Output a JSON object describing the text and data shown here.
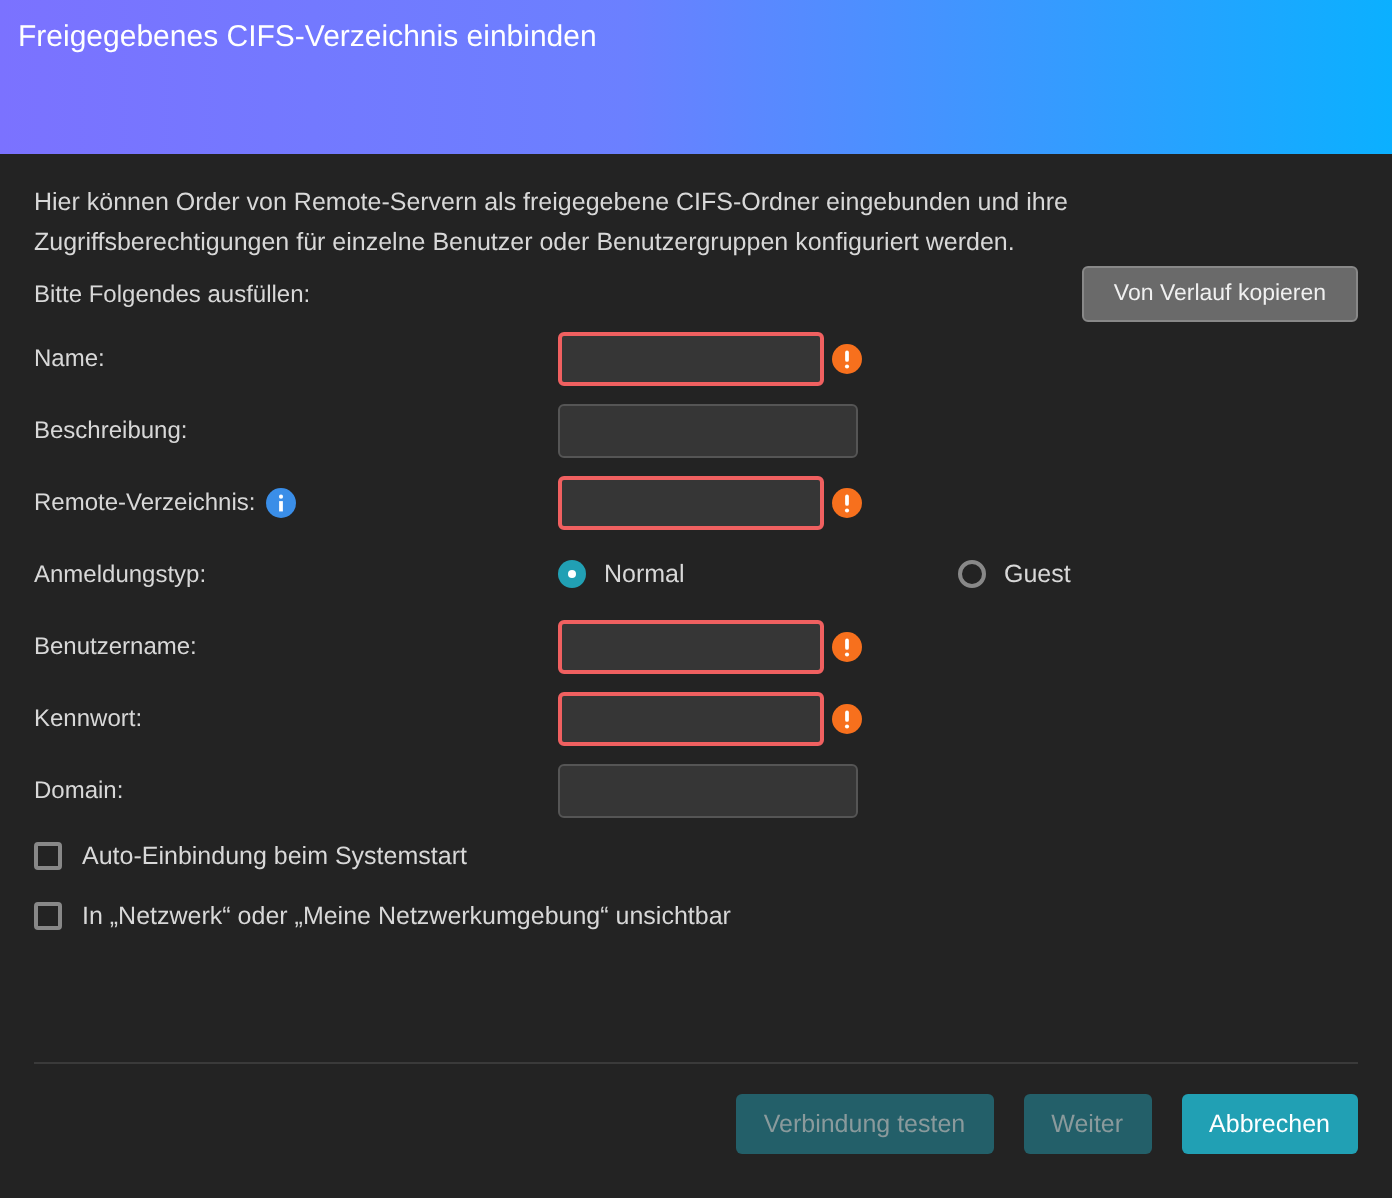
{
  "window": {
    "title": "Freigegebenes CIFS-Verzeichnis einbinden"
  },
  "intro": "Hier können Order von Remote-Servern als freigegebene CIFS-Ordner eingebunden und ihre Zugriffsberechtigungen für einzelne Benutzer oder Benutzergruppen konfiguriert werden.",
  "prompt": "Bitte Folgendes ausfüllen:",
  "history_button": "Von Verlauf kopieren",
  "fields": [
    {
      "kind": "text",
      "label": "Name:",
      "required": true,
      "info": false
    },
    {
      "kind": "text",
      "label": "Beschreibung:",
      "required": false,
      "info": false
    },
    {
      "kind": "text",
      "label": "Remote-Verzeichnis:",
      "required": true,
      "info": true
    },
    {
      "kind": "radio",
      "label": "Anmeldungstyp:",
      "options": [
        {
          "label": "Normal",
          "selected": true
        },
        {
          "label": "Guest",
          "selected": false
        }
      ]
    },
    {
      "kind": "text",
      "label": "Benutzername:",
      "required": true,
      "info": false
    },
    {
      "kind": "text",
      "label": "Kennwort:",
      "required": true,
      "info": false
    },
    {
      "kind": "text",
      "label": "Domain:",
      "required": false,
      "info": false
    }
  ],
  "checkboxes": [
    {
      "label": "Auto-Einbindung beim Systemstart",
      "checked": false
    },
    {
      "label": "In „Netzwerk“ oder „Meine Netzwerkumgebung“ unsichtbar",
      "checked": false
    }
  ],
  "buttons": [
    {
      "label": "Verbindung testen",
      "disabled": true
    },
    {
      "label": "Weiter",
      "disabled": true
    },
    {
      "label": "Abbrechen",
      "disabled": false
    }
  ]
}
